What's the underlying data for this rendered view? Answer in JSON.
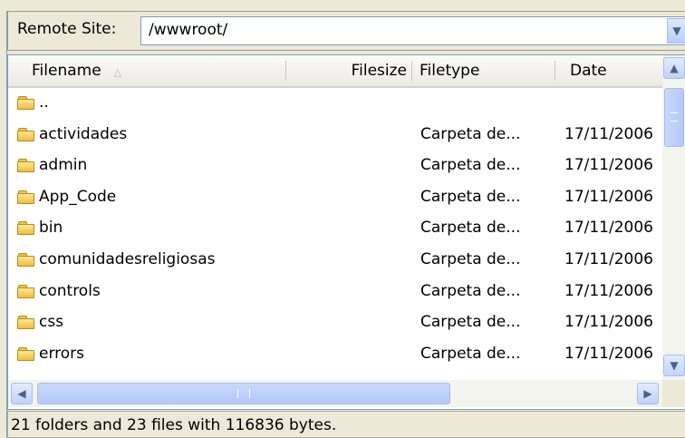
{
  "address": {
    "label": "Remote Site:",
    "value": "/wwwroot/"
  },
  "columns": {
    "filename": "Filename",
    "filesize": "Filesize",
    "filetype": "Filetype",
    "date": "Date"
  },
  "rows": [
    {
      "name": "..",
      "type": "",
      "date": ""
    },
    {
      "name": "actividades",
      "type": "Carpeta de...",
      "date": "17/11/2006"
    },
    {
      "name": "admin",
      "type": "Carpeta de...",
      "date": "17/11/2006"
    },
    {
      "name": "App_Code",
      "type": "Carpeta de...",
      "date": "17/11/2006"
    },
    {
      "name": "bin",
      "type": "Carpeta de...",
      "date": "17/11/2006"
    },
    {
      "name": "comunidadesreligiosas",
      "type": "Carpeta de...",
      "date": "17/11/2006"
    },
    {
      "name": "controls",
      "type": "Carpeta de...",
      "date": "17/11/2006"
    },
    {
      "name": "css",
      "type": "Carpeta de...",
      "date": "17/11/2006"
    },
    {
      "name": "errors",
      "type": "Carpeta de...",
      "date": "17/11/2006"
    }
  ],
  "status": "21 folders and 23 files with 116836 bytes.",
  "icons": {
    "folder": "folder-icon",
    "sort": "sort-ascending-icon",
    "combo": "chevron-down-icon",
    "scroll_up": "arrow-up-icon",
    "scroll_down": "arrow-down-icon",
    "scroll_left": "arrow-left-icon",
    "scroll_right": "arrow-right-icon"
  },
  "colors": {
    "window_bg": "#ece9d8",
    "border": "#7f9db9",
    "scroll_accent": "#c1d3fb",
    "folder": "#efbf3c"
  }
}
